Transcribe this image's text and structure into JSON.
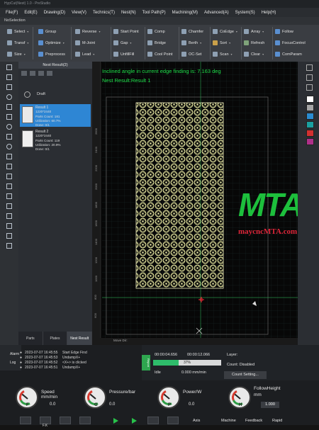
{
  "window": {
    "title": "HypCut(Nest) 1.0 - PreStudio"
  },
  "menu": [
    "File(F)",
    "Edit(E)",
    "Drawing(D)",
    "View(V)",
    "Technics(T)",
    "Nest(N)",
    "Tool Path(P)",
    "Machining(M)",
    "Advanced(A)",
    "System(S)",
    "Help(H)"
  ],
  "selection_status": "NoSelection",
  "ribbon": {
    "select": "Select",
    "transf": "Transf",
    "size": "Size",
    "group": "Group",
    "optimize": "Optimize",
    "preprocess": "Preprocess",
    "reverse": "Reverse",
    "m_joint": "M-Joint",
    "lead": "Lead",
    "start_point": "Start Point",
    "gap": "Gap",
    "unfill": "UnfillFill",
    "comp": "Comp",
    "bridge": "Bridge",
    "cool_point": "Cool Point",
    "chamfer": "Chamfer",
    "berth": "Berth",
    "oc_set": "OC-Set",
    "coedge": "CoEdge",
    "sort": "Sort",
    "scan": "Scan",
    "array": "Array",
    "refresh": "Refresh",
    "clear": "Clear",
    "follow": "Follow",
    "focus_control": "FocusControl",
    "com_param": "ComParam"
  },
  "nest": {
    "header": "Nest Result(2)",
    "draft": "Draft",
    "results": [
      {
        "name": "Result 1",
        "size": "1220*2440",
        "parts": "Parts Count: 181",
        "util": "Utilization: 60.7%",
        "done": "Done: 0/1"
      },
      {
        "name": "Result 2",
        "size": "1220*2440",
        "parts": "Parts Count: 119",
        "util": "Utilization: 20.9%",
        "done": "Done: 0/1"
      }
    ],
    "tabs": [
      "Parts",
      "Plates",
      "Nest Result"
    ]
  },
  "canvas": {
    "info_line1": "Inclined angle in current edge finding is: 7.163 deg",
    "info_line2": "Nest Result:Result 1",
    "move_dir": "Move Dir:",
    "ticks_y": [
      "2600",
      "2400",
      "2200",
      "2000",
      "1800",
      "1600",
      "1400",
      "1200",
      "1000",
      "800",
      "600",
      "400",
      "200",
      "0",
      "-200"
    ],
    "ticks_x": [
      "-400",
      "-200",
      "0",
      "200",
      "400",
      "600",
      "800",
      "1000",
      "1200",
      "1400",
      "1600",
      "1800",
      "2000",
      "2200"
    ]
  },
  "watermark": {
    "logo": "MTA",
    "url": "maycncMTA.com"
  },
  "colors": {
    "accent": "#2e86d4",
    "info_text": "#1ee04a",
    "progress": "#2ebd6b",
    "watermark_green": "#1dbf3c",
    "watermark_red": "#e0263a",
    "swatches": [
      "#ffffff",
      "#a6a6a6",
      "#2a8bd0",
      "#1aa0a0",
      "#d23030",
      "#b0308a"
    ]
  },
  "log": {
    "tabs": [
      "Alarm",
      "Log"
    ],
    "entries": [
      {
        "time": "2023-07-07 16:45:55",
        "msg": "Start Edge Find"
      },
      {
        "time": "2023-07-07 16:45:53",
        "msg": "UndampX+"
      },
      {
        "time": "2023-07-07 16:45:52",
        "msg": "<X+> is clicked"
      },
      {
        "time": "2023-07-07 16:45:51",
        "msg": "UndampX+"
      }
    ]
  },
  "process": {
    "time1": "00:00:04.656",
    "time2": "00:00:12.066",
    "progress_pct": 37,
    "progress_label": "37%",
    "status": "Idle",
    "speed": "0.000 mm/min",
    "layer_label": "Layer:",
    "count_status": "Count: Disabled",
    "count_setting": "Count Setting...",
    "report": "Report"
  },
  "gauges": [
    {
      "label": "Speed",
      "unit": "mm/min",
      "value": "0.0",
      "letter": "F"
    },
    {
      "label": "Pressure/bar",
      "unit": "",
      "value": "0.0",
      "letter": "G"
    },
    {
      "label": "Power/W",
      "unit": "",
      "value": "0.0",
      "letter": "P"
    },
    {
      "label": "FollowHeight",
      "unit": "mm",
      "value": "1.000",
      "letter": "H"
    }
  ],
  "controls": {
    "axis": "Axis",
    "machine": "Machine",
    "feedback": "Feedback",
    "rapid": "Rapid",
    "fk": "F.K"
  }
}
